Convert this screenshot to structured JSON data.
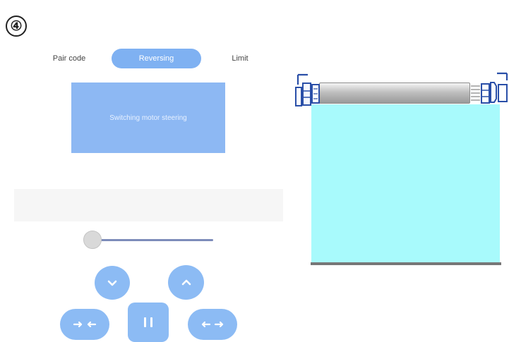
{
  "step": {
    "number": "④"
  },
  "tabs": [
    {
      "label": "Pair code",
      "selected": false
    },
    {
      "label": "Reversing",
      "selected": true
    },
    {
      "label": "Limit",
      "selected": false
    }
  ],
  "mode_card": {
    "text": "Switching motor steering"
  },
  "slider": {
    "value": 0
  },
  "controls": {
    "down_icon": "chevron-down-icon",
    "up_icon": "chevron-up-icon",
    "close_icon": "arrows-inward-icon",
    "pause_icon": "pause-icon",
    "open_icon": "arrows-outward-icon"
  },
  "colors": {
    "accent": "#7fb1f2",
    "button": "#8cbbf4",
    "fabric": "#a8fafc",
    "bracket": "#2a4fa8",
    "slider_track": "#7d8cba"
  }
}
